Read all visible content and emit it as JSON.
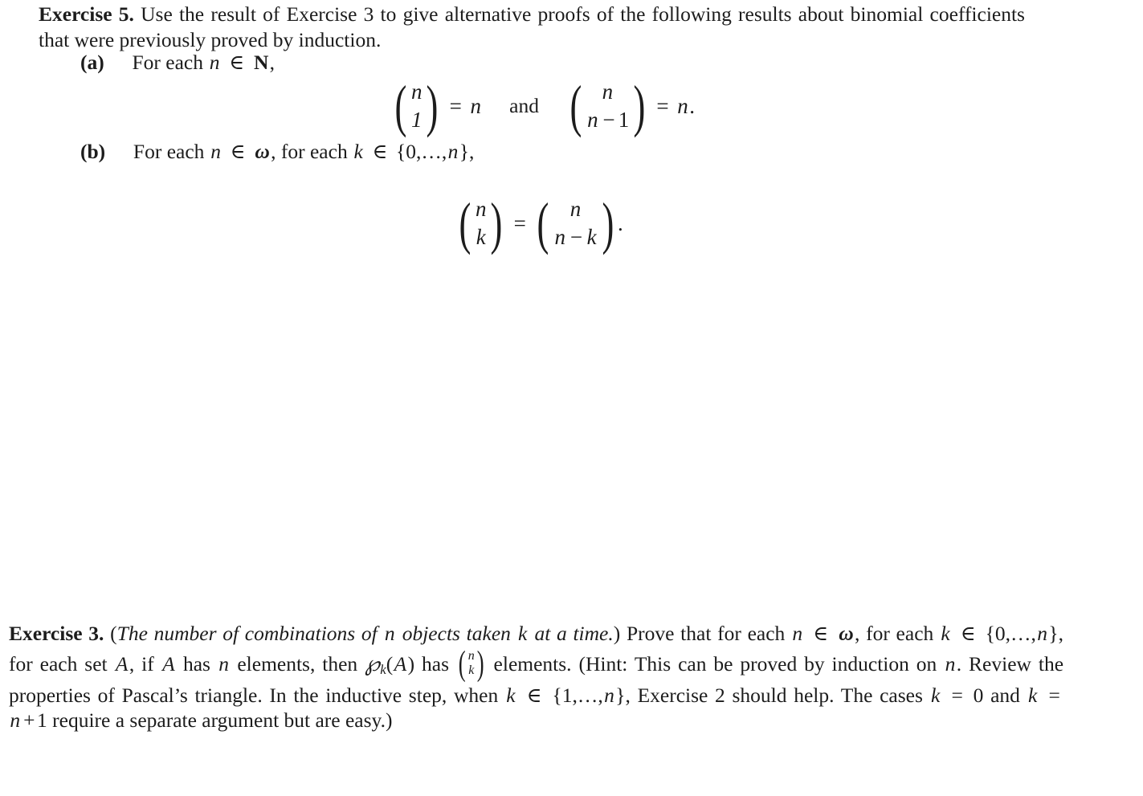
{
  "document": {
    "text_color": "#1c1c1c",
    "background_color": "#ffffff",
    "exercise5": {
      "label": "Exercise 5.",
      "body": "Use the result of Exercise 3 to give alternative proofs of the following results about binomial coefficients that were previously proved by induction.",
      "item_a": {
        "marker": "(a)",
        "text_before": "For each",
        "var_n": "n",
        "member_op": "∈",
        "set_N": "N",
        "comma": ",",
        "equation": {
          "left_binomial": {
            "top": "n",
            "bottom": "1"
          },
          "relation": "=",
          "right_value": "n",
          "conjunction": "and",
          "second_binomial": {
            "top": "n",
            "bottom_var": "n",
            "bottom_op": "−",
            "bottom_num": "1"
          },
          "second_relation": "=",
          "second_value": "n",
          "terminator": "."
        }
      },
      "item_b": {
        "marker": "(b)",
        "text_for_each": "For each",
        "var_n": "n",
        "member_op": "∈",
        "set_omega": "ω",
        "separator": ", for each",
        "var_k": "k",
        "member_op2": "∈",
        "set_open": "{",
        "set_zero": "0",
        "set_ellipsis": ",…,",
        "set_n": "n",
        "set_close": "}",
        "comma": ",",
        "equation": {
          "left_binomial": {
            "top": "n",
            "bottom": "k"
          },
          "relation": "=",
          "right_binomial": {
            "top": "n",
            "bottom_var": "n",
            "bottom_op": "−",
            "bottom_var2": "k"
          },
          "terminator": "."
        }
      }
    },
    "exercise3": {
      "label": "Exercise 3.",
      "paren_open": "(",
      "italic_title_part1": "The number of combinations of",
      "italic_var_n": "n",
      "italic_title_part2": "objects taken",
      "italic_var_k": "k",
      "italic_title_part3": "at a time.",
      "paren_close": ")",
      "sentence1_a": "Prove that for each",
      "var_n": "n",
      "member_op": "∈",
      "set_omega": "ω",
      "sentence1_b": ", for each",
      "var_k": "k",
      "member_op2": "∈",
      "set_open": "{",
      "set_zero": "0",
      "set_ellipsis": ",…,",
      "set_n": "n",
      "set_close": "}",
      "sentence1_c": ", for each set",
      "var_A": "A",
      "sentence1_d": ", if",
      "var_A2": "A",
      "sentence1_e": "has",
      "var_n2": "n",
      "sentence1_f": "elements, then",
      "script_P": "℘",
      "script_P_sub": "k",
      "paren_A_open": "(",
      "var_A3": "A",
      "paren_A_close": ")",
      "sentence1_g": "has",
      "binomial": {
        "top": "n",
        "bottom": "k"
      },
      "sentence1_h": "elements.",
      "hint_open": "(Hint: This can be proved by induction on",
      "var_n3": "n",
      "hint_b": ". Review the properties of Pascal’s triangle. In the inductive step, when",
      "var_k2": "k",
      "member_op3": "∈",
      "hint_set_open": "{",
      "hint_set_one": "1",
      "hint_set_ellipsis": ",…,",
      "hint_set_n": "n",
      "hint_set_close": "}",
      "hint_c": ", Exercise 2 should help. The cases",
      "var_k3": "k",
      "eq1": "=",
      "val_0": "0",
      "hint_and": "and",
      "var_k4": "k",
      "eq2": "=",
      "val_n": "n",
      "plus": "+",
      "val_1": "1",
      "hint_d": "require a separate argument but are easy.)"
    }
  }
}
